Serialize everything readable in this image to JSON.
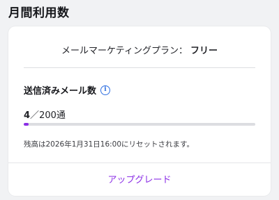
{
  "section": {
    "title": "月間利用数"
  },
  "plan": {
    "label": "メールマーケティングプラン：",
    "value": "フリー"
  },
  "usage": {
    "label": "送信済みメール数",
    "info_icon": "i",
    "used": "4",
    "separator": "／",
    "limit": "200通",
    "progress_fraction": 0.02,
    "reset_note": "残高は2026年1月31日16:00にリセットされます。"
  },
  "actions": {
    "upgrade_label": "アップグレード"
  },
  "colors": {
    "accent": "#8b2ee6",
    "info": "#2f6fe0",
    "background": "#f1f2f4"
  }
}
